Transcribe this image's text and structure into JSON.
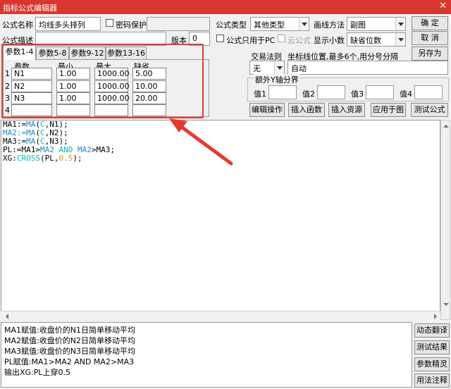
{
  "window": {
    "title": "指标公式编辑器",
    "close": "✕"
  },
  "form": {
    "name_label": "公式名称",
    "name_value": "均线多头排列",
    "password_label": "密码保护",
    "desc_label": "公式描述",
    "version_label": "版本",
    "version_value": "0",
    "type_label": "公式类型",
    "type_value": "其他类型",
    "draw_label": "画线方法",
    "draw_value": "副图",
    "pc_only_label": "公式只用于PC",
    "cloud_label": "云公式",
    "decimals_label": "显示小数",
    "decimals_value": "缺省位数",
    "trade_rule_label": "交易法则",
    "trade_rule_value": "无",
    "coord_label": "坐标线位置,最多6个,用分号分隔",
    "coord_value": "自动",
    "extra_y_label": "额外Y轴分界",
    "val_labels": [
      "值1",
      "值2",
      "值3",
      "值4"
    ]
  },
  "buttons": {
    "ok": "确 定",
    "cancel": "取 消",
    "save_as": "另存为",
    "edit_ops": "编辑操作",
    "insert_func": "插入函数",
    "insert_res": "插入资源",
    "apply_chart": "应用于图",
    "test_formula": "测试公式",
    "dyn_translate": "动态翻译",
    "test_result": "测试结果",
    "param_wizard": "参数精灵",
    "usage_notes": "用法注释"
  },
  "tabs": [
    "参数1-4",
    "参数5-8",
    "参数9-12",
    "参数13-16"
  ],
  "params": {
    "headers": [
      "参数",
      "最小",
      "最大",
      "缺省"
    ],
    "rows": [
      {
        "n": "1",
        "name": "N1",
        "min": "1.00",
        "max": "1000.00",
        "def": "5.00"
      },
      {
        "n": "2",
        "name": "N2",
        "min": "1.00",
        "max": "1000.00",
        "def": "10.00"
      },
      {
        "n": "3",
        "name": "N3",
        "min": "1.00",
        "max": "1000.00",
        "def": "20.00"
      },
      {
        "n": "4",
        "name": "",
        "min": "",
        "max": "",
        "def": ""
      }
    ]
  },
  "code": {
    "line1": [
      "MA1:=",
      "MA",
      "(",
      "C",
      ",N1);"
    ],
    "line2": [
      "MA2:=",
      "MA",
      "(",
      "C",
      ",N2);"
    ],
    "line3": [
      "MA3:=",
      "MA",
      "(",
      "C",
      ",N3);"
    ],
    "line4": [
      "PL:=MA1>",
      "MA2",
      " AND ",
      "MA2",
      ">MA3;"
    ],
    "line5": [
      "XG:",
      "CROSS",
      "(PL,",
      "0.5",
      ");"
    ]
  },
  "description": [
    "MA1赋值:收盘价的N1日简单移动平均",
    "MA2赋值:收盘价的N2日简单移动平均",
    "MA3赋值:收盘价的N3日简单移动平均",
    "PL赋值:MA1>MA2 AND MA2>MA3",
    "输出XG:PL上穿0.5"
  ],
  "colors": {
    "title_bar": "#d8372f",
    "highlight": "#e63a30",
    "keyword": "#1e88c8",
    "constant": "#e0a000"
  }
}
